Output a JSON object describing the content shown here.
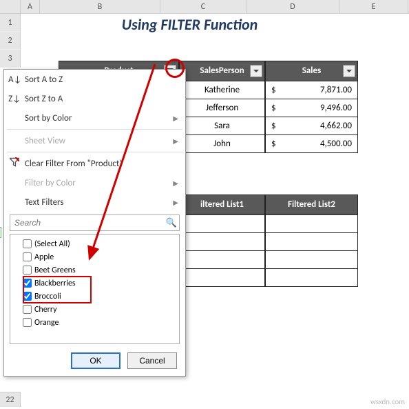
{
  "columns": [
    "A",
    "B",
    "C",
    "D",
    "E"
  ],
  "rows": [
    "1",
    "2",
    "3"
  ],
  "title": "Using FILTER Function",
  "headers": {
    "product": "Product",
    "salesperson": "SalesPerson",
    "sales": "Sales",
    "fl1": "iltered List1",
    "fl2": "Filtered List2"
  },
  "data_rows": [
    {
      "person": "Katherine",
      "cur": "$",
      "amount": "7,871.00"
    },
    {
      "person": "Jefferson",
      "cur": "$",
      "amount": "9,496.00"
    },
    {
      "person": "Sara",
      "cur": "$",
      "amount": "4,662.00"
    },
    {
      "person": "John",
      "cur": "$",
      "amount": "4,500.00"
    }
  ],
  "menu": {
    "sort_az": "Sort A to Z",
    "sort_za": "Sort Z to A",
    "sort_color": "Sort by Color",
    "sheet_view": "Sheet View",
    "clear": "Clear Filter From \"Product\"",
    "filter_color": "Filter by Color",
    "text_filters": "Text Filters",
    "search_placeholder": "Search",
    "items": [
      "(Select All)",
      "Apple",
      "Beet Greens",
      "Blackberries",
      "Broccoli",
      "Cherry",
      "Orange"
    ],
    "checked": [
      false,
      false,
      false,
      true,
      true,
      false,
      false
    ],
    "ok": "OK",
    "cancel": "Cancel"
  },
  "row22": "22",
  "watermark": "wsxdn.com"
}
